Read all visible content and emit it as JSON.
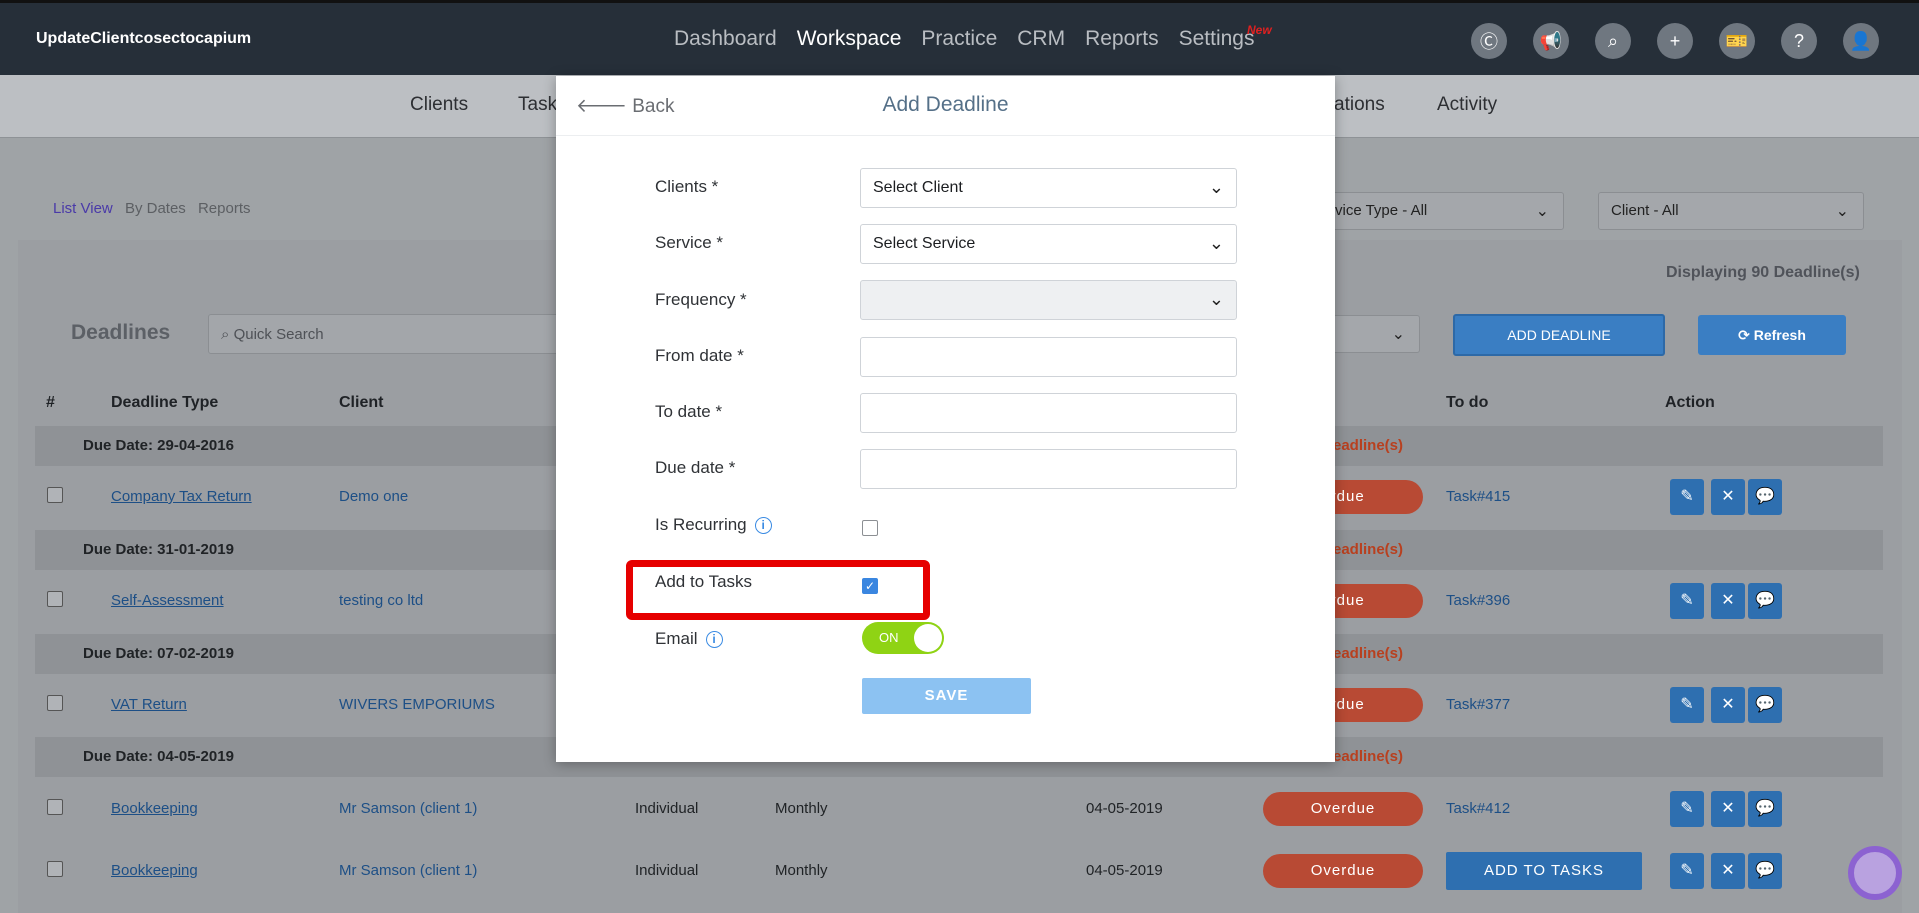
{
  "app": {
    "title": "UpdateClientcosectocapium",
    "nav": [
      "Dashboard",
      "Workspace",
      "Practice",
      "CRM",
      "Reports",
      "Settings"
    ],
    "new_tag": "New"
  },
  "subnav": {
    "items": [
      "Clients",
      "Tasks",
      "ations",
      "Activity"
    ]
  },
  "view_tabs": [
    "List View",
    "By Dates",
    "Reports"
  ],
  "filters": {
    "service_type": "vice Type - All",
    "client": "Client - All"
  },
  "displaying": "Displaying 90 Deadline(s)",
  "deadlines_title": "Deadlines",
  "search_placeholder": "Quick Search",
  "buttons": {
    "add_deadline": "ADD DEADLINE",
    "refresh": "Refresh",
    "add_to_tasks": "ADD TO TASKS"
  },
  "table": {
    "headers": [
      "#",
      "Deadline Type",
      "Client",
      "To do",
      "Action"
    ],
    "groups": [
      {
        "label": "Due Date: 29-04-2016",
        "count": "eadline(s)"
      },
      {
        "label": "Due Date: 31-01-2019",
        "count": "eadline(s)"
      },
      {
        "label": "Due Date: 07-02-2019",
        "count": "eadline(s)"
      },
      {
        "label": "Due Date: 04-05-2019",
        "count": "eadline(s)"
      }
    ],
    "rows": [
      {
        "type": "Company Tax Return",
        "client": "Demo one",
        "status": "erdue",
        "todo": "Task#415"
      },
      {
        "type": "Self-Assessment",
        "client": "testing co ltd",
        "status": "erdue",
        "todo": "Task#396"
      },
      {
        "type": "VAT Return",
        "client": "WIVERS EMPORIUMS",
        "status": "erdue",
        "todo": "Task#377"
      },
      {
        "type": "Bookkeeping",
        "client": "Mr Samson (client 1)",
        "entity": "Individual",
        "frequency": "Monthly",
        "date": "04-05-2019",
        "status": "Overdue",
        "todo": "Task#412"
      },
      {
        "type": "Bookkeeping",
        "client": "Mr Samson (client 1)",
        "entity": "Individual",
        "frequency": "Monthly",
        "date": "04-05-2019",
        "status": "Overdue",
        "todo": ""
      }
    ]
  },
  "modal": {
    "back": "Back",
    "title": "Add Deadline",
    "fields": {
      "clients": {
        "label": "Clients *",
        "value": "Select Client"
      },
      "service": {
        "label": "Service *",
        "value": "Select Service"
      },
      "frequency": {
        "label": "Frequency *",
        "value": ""
      },
      "from_date": {
        "label": "From date *"
      },
      "to_date": {
        "label": "To date *"
      },
      "due_date": {
        "label": "Due date *"
      },
      "is_recurring": {
        "label": "Is Recurring",
        "checked": false
      },
      "add_to_tasks": {
        "label": "Add to Tasks",
        "checked": true
      },
      "email": {
        "label": "Email",
        "toggle": "ON"
      }
    },
    "save": "SAVE"
  },
  "colors": {
    "accent": "#3a86e0",
    "highlight": "#e60000",
    "toggle_on": "#8fd314",
    "overdue": "#e8694a"
  }
}
